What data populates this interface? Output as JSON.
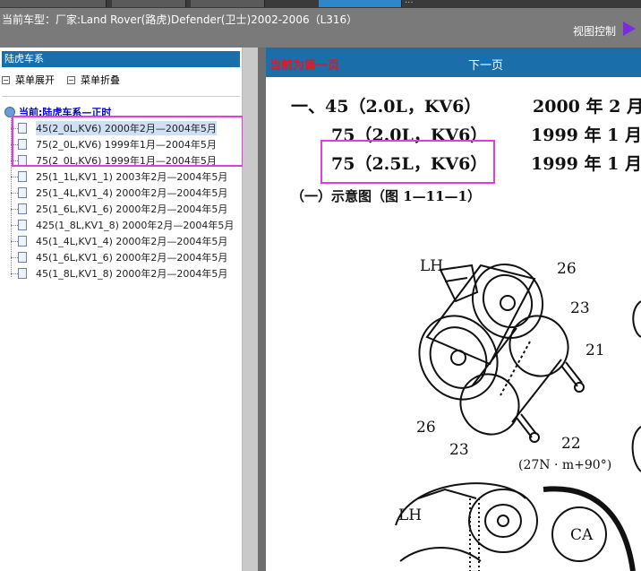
{
  "header": {
    "car_type": "当前车型：厂家:Land Rover(路虎)Defender(卫士)2002-2006（L316）",
    "view_control": "视图控制"
  },
  "toolbar": {
    "dots": "..."
  },
  "left_panel": {
    "title": "陆虎车系",
    "expand_menu": "菜单展开",
    "collapse_menu": "菜单折叠",
    "root_label": "当前:陆虎车系—正时",
    "items": [
      "45(2_0L,KV6) 2000年2月—2004年5月",
      "75(2_0L,KV6) 1999年1月—2004年5月",
      "75(2_0L,KV6) 1999年1月—2004年5月",
      "25(1_1L,KV1_1) 2003年2月—2004年5月",
      "25(1_4L,KV1_4) 2000年2月—2004年5月",
      "25(1_6L,KV1_6) 2000年2月—2004年5月",
      "425(1_8L,KV1_8) 2000年2月—2004年5月",
      "45(1_4L,KV1_4) 2000年2月—2004年5月",
      "45(1_6L,KV1_6) 2000年2月—2004年5月",
      "45(1_8L,KV1_8) 2000年2月—2004年5月"
    ]
  },
  "viewer": {
    "current_page": "当前为第一页",
    "next_page": "下一页",
    "line1_spec": "一、45（2.0L，KV6）",
    "line1_date": "2000 年 2 月",
    "line2_spec": "75（2.0L，KV6）",
    "line2_date": "1999 年 1 月",
    "line3_spec": "75（2.5L，KV6）",
    "line3_date": "1999 年 1 月",
    "subheading": "（一）示意图（图 1—11—1）",
    "diagram_labels": {
      "lh1": "LH",
      "n26a": "26",
      "n23a": "23",
      "n21": "21",
      "n26b": "26",
      "n23b": "23",
      "n22": "22",
      "torque": "(27N · m+90°)",
      "lh2": "LH",
      "ca": "CA"
    }
  },
  "colors": {
    "header_bg": "#7a7a7a",
    "panel_blue": "#1a6faa",
    "highlight_pink": "#e03ce0",
    "current_page_red": "#e8141f"
  }
}
